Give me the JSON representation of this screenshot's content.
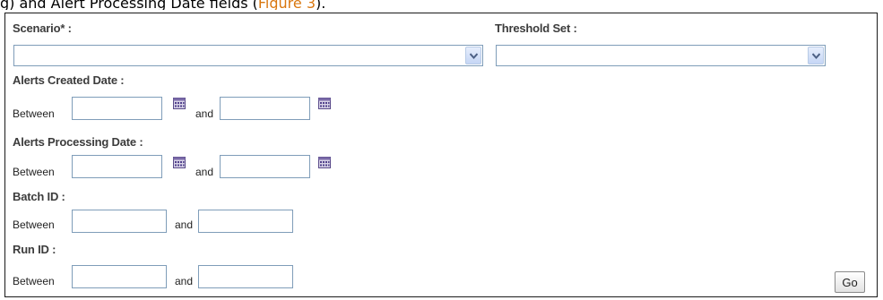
{
  "caption": {
    "text": "g) and Alert Processing Date fields (",
    "link": "Figure 3",
    "suffix": ")."
  },
  "form": {
    "scenario": {
      "label": "Scenario* :",
      "value": ""
    },
    "threshold_set": {
      "label": "Threshold Set :",
      "value": ""
    },
    "alerts_created_date": {
      "label": "Alerts Created Date :",
      "between": "Between",
      "and": "and",
      "from": "",
      "to": ""
    },
    "alerts_processing_date": {
      "label": "Alerts Processing Date :",
      "between": "Between",
      "and": "and",
      "from": "",
      "to": ""
    },
    "batch_id": {
      "label": "Batch ID :",
      "between": "Between",
      "and": "and",
      "from": "",
      "to": ""
    },
    "run_id": {
      "label": "Run ID :",
      "between": "Between",
      "and": "and",
      "from": "",
      "to": ""
    },
    "go_label": "Go"
  },
  "icons": {
    "calendar": "calendar-icon",
    "dropdown": "chevron-down-icon"
  },
  "colors": {
    "field_border": "#7f9db9",
    "label_text": "#3c3c3c",
    "caption_link": "#d9770f"
  }
}
